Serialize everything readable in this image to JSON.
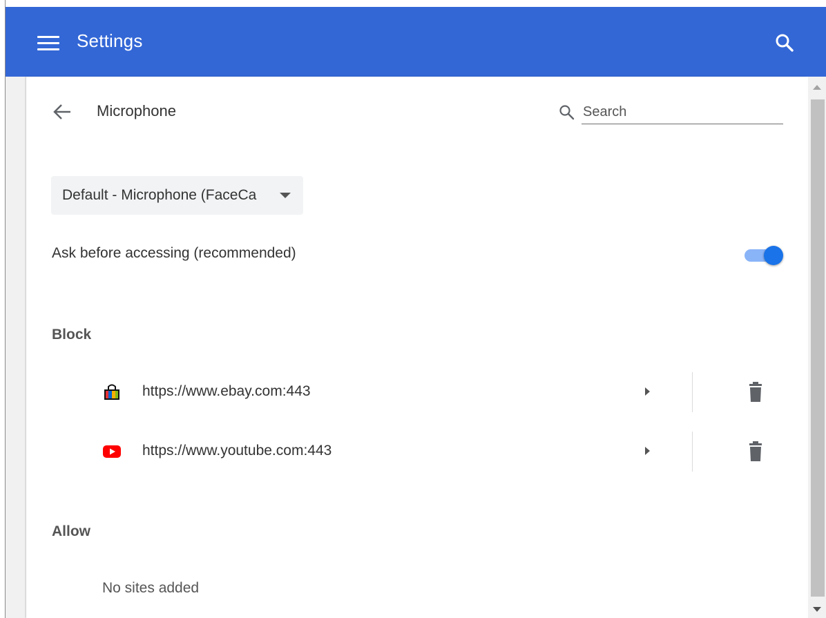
{
  "header": {
    "title": "Settings",
    "menu_icon": "hamburger-menu-icon",
    "search_icon": "search-icon",
    "bg_color": "#3367d6"
  },
  "page": {
    "title": "Microphone",
    "back_icon": "back-arrow-icon",
    "search_placeholder": "Search",
    "search_value": ""
  },
  "device_select": {
    "selected": "Default - Microphone (FaceCa"
  },
  "ask_setting": {
    "label": "Ask before accessing (recommended)",
    "enabled": true,
    "accent": "#1a73e8"
  },
  "block": {
    "heading": "Block",
    "sites": [
      {
        "url": "https://www.ebay.com:443",
        "favicon": "ebay-favicon-icon"
      },
      {
        "url": "https://www.youtube.com:443",
        "favicon": "youtube-favicon-icon"
      }
    ]
  },
  "allow": {
    "heading": "Allow",
    "empty_text": "No sites added"
  }
}
